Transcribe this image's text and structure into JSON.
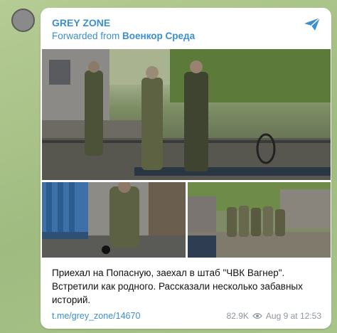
{
  "post": {
    "channel_name": "GREY ZONE",
    "forwarded_prefix": "Forwarded from ",
    "forwarded_source": "Военкор Среда",
    "caption": "Приехал на Попасную, заехал в штаб \"ЧВК Вагнер\". Встретили как родного. Рассказали несколько забавных историй.",
    "link": "t.me/grey_zone/14670",
    "views": "82.9K",
    "date": "Aug 9 at 12:53"
  },
  "colors": {
    "accent": "#3a8fd0",
    "bubble": "#ffffff",
    "wallpaper": "#a9c28a"
  },
  "icons": {
    "share": "share-icon",
    "views": "eye-icon"
  }
}
